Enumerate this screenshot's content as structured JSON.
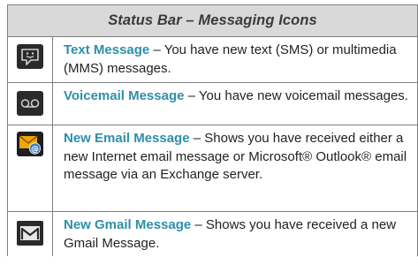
{
  "table": {
    "title": "Status Bar – Messaging Icons",
    "dash": "–",
    "rows": [
      {
        "icon": "text-message-icon",
        "term": "Text Message",
        "description": "You have new text (SMS) or multimedia (MMS) messages."
      },
      {
        "icon": "voicemail-icon",
        "term": "Voicemail Message",
        "description": "You have new voicemail messages."
      },
      {
        "icon": "email-icon",
        "term": "New Email Message",
        "description": "Shows you have received either a new Internet email message or Microsoft® Outlook® email message via an Exchange server."
      },
      {
        "icon": "gmail-icon",
        "term": "New Gmail Message",
        "description": "Shows you have received a new Gmail Message."
      }
    ]
  },
  "colors": {
    "term": "#2e8fa8",
    "header_bg": "#d9d9d9",
    "border": "#7f7f7f",
    "icon_bg": "#2a2a2a"
  }
}
